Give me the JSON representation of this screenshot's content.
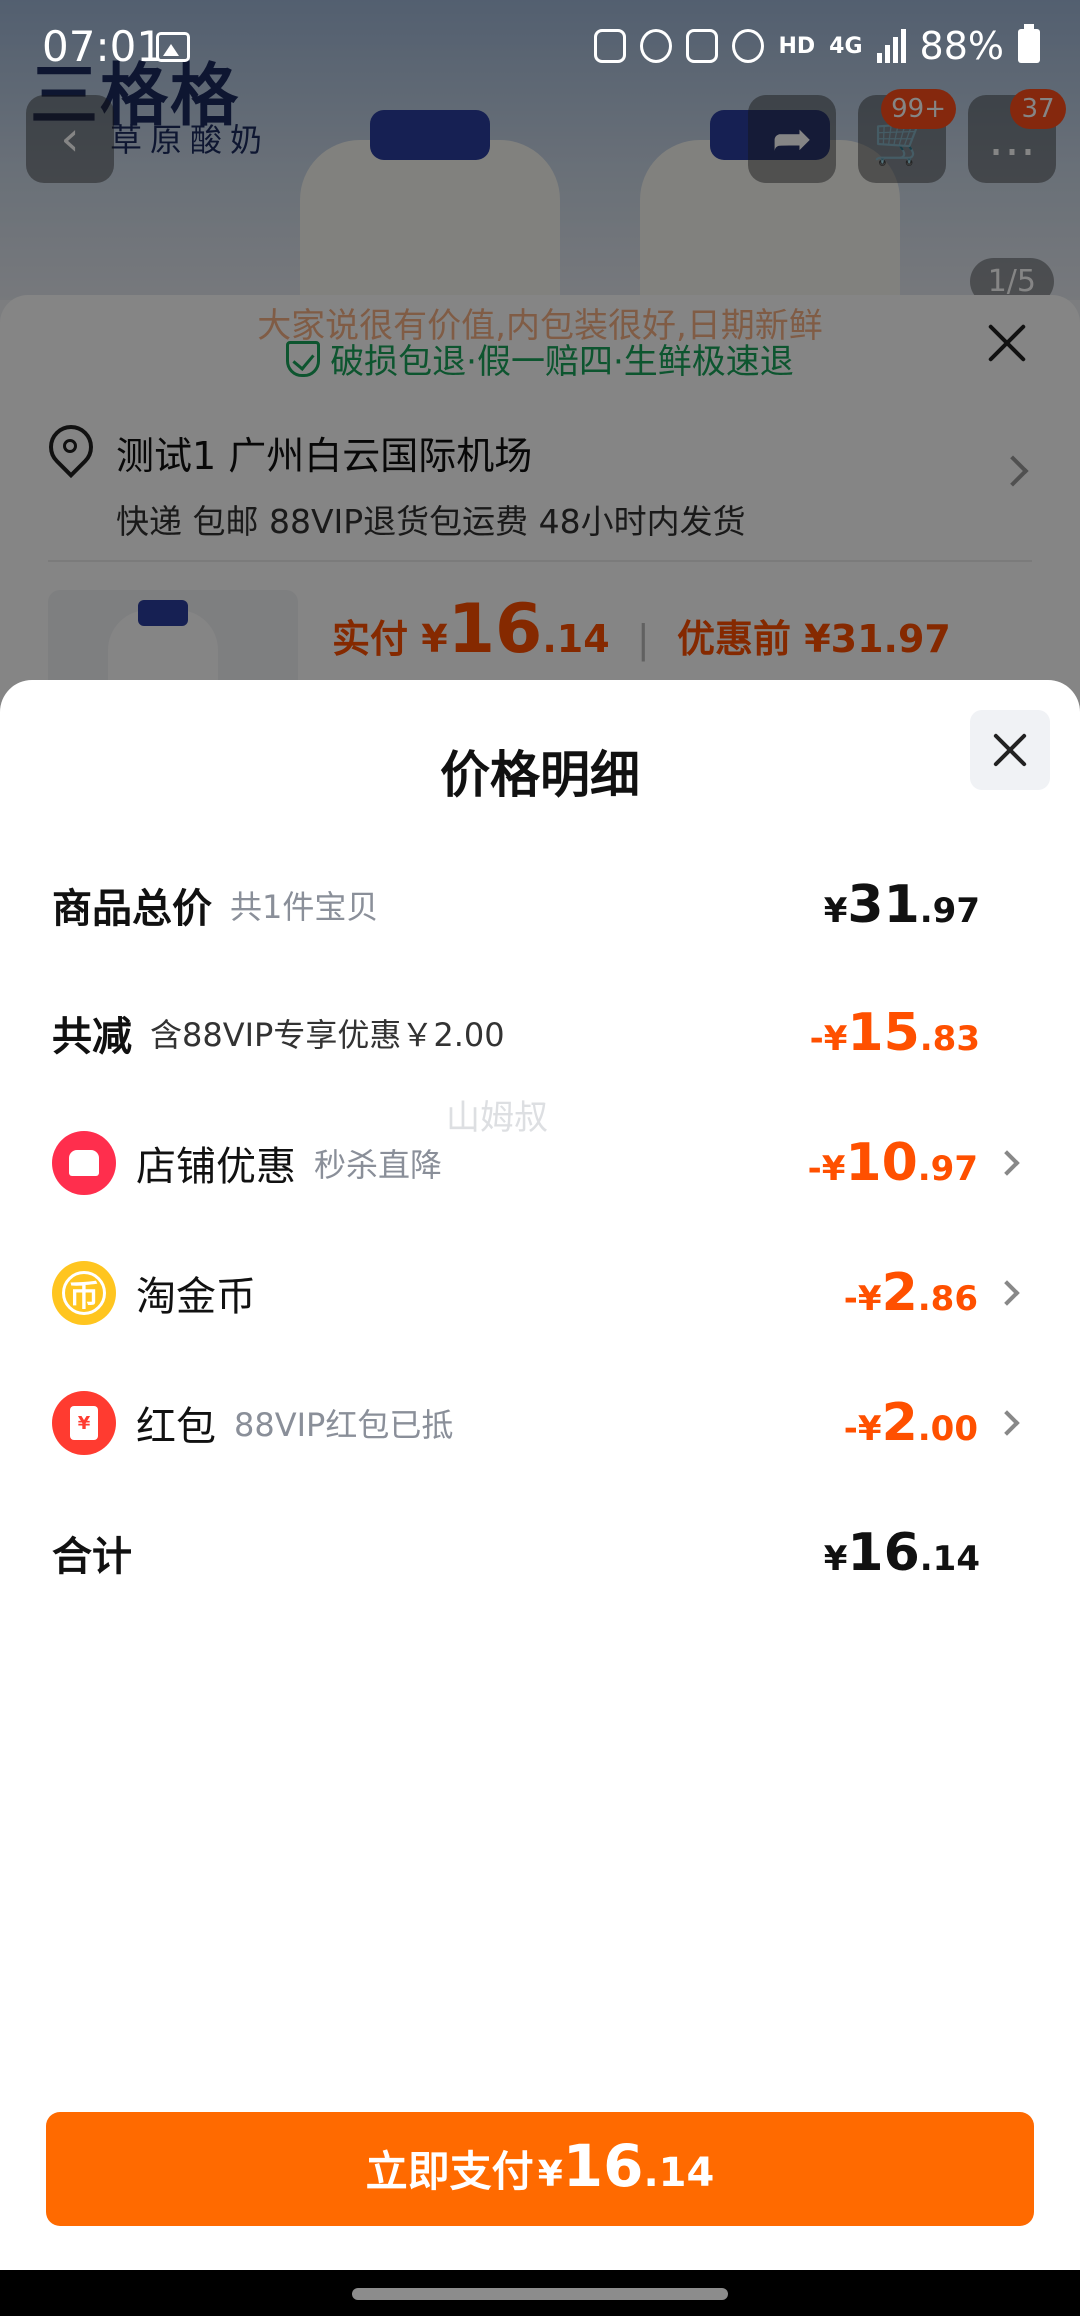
{
  "status_bar": {
    "time": "07:01",
    "hd": "HD",
    "net": "4G",
    "battery": "88%"
  },
  "background": {
    "brand_name": "三格格",
    "brand_sub": "草原酸奶",
    "cart_badge": "99+",
    "msg_badge": "37",
    "image_counter": "1/5",
    "tips": "大家说很有价值,内包装很好,日期新鲜",
    "guarantee": "破损包退·假一赔四·生鲜极速退",
    "address_line1": "测试1 广州白云国际机场",
    "address_line2": "快递 包邮 88VIP退货包运费 48小时内发货",
    "paid_label": "实付",
    "paid_yen": "¥",
    "paid_int": "16",
    "paid_dec": ".14",
    "before_label": "优惠前",
    "before_amount": "¥31.97"
  },
  "sheet": {
    "title": "价格明细",
    "watermark": "山姆叔",
    "rows": {
      "total": {
        "label": "商品总价",
        "sub": "共1件宝贝",
        "yen": "¥",
        "int": "31",
        "dec": ".97"
      },
      "reduce": {
        "label": "共减",
        "sub": "含88VIP专享优惠￥2.00",
        "yen": "-¥",
        "int": "15",
        "dec": ".83"
      },
      "shop": {
        "label": "店铺优惠",
        "sub": "秒杀直降",
        "yen": "-¥",
        "int": "10",
        "dec": ".97"
      },
      "coin": {
        "label": "淘金币",
        "icon_glyph": "币",
        "yen": "-¥",
        "int": "2",
        "dec": ".86"
      },
      "redpacket": {
        "label": "红包",
        "icon_glyph": "¥",
        "sub": "88VIP红包已抵",
        "yen": "-¥",
        "int": "2",
        "dec": ".00"
      },
      "sum": {
        "label": "合计",
        "yen": "¥",
        "int": "16",
        "dec": ".14"
      }
    },
    "pay_button": {
      "label": "立即支付",
      "yen": "¥",
      "int": "16",
      "dec": ".14"
    }
  },
  "colors": {
    "accent": "#ff5000",
    "button": "#ff6a00",
    "guarantee": "#19a35a"
  },
  "icons": [
    "gallery-icon",
    "close-icon",
    "location-icon",
    "chevron-right-icon",
    "shop-coupon-icon",
    "coin-icon",
    "red-packet-icon"
  ]
}
